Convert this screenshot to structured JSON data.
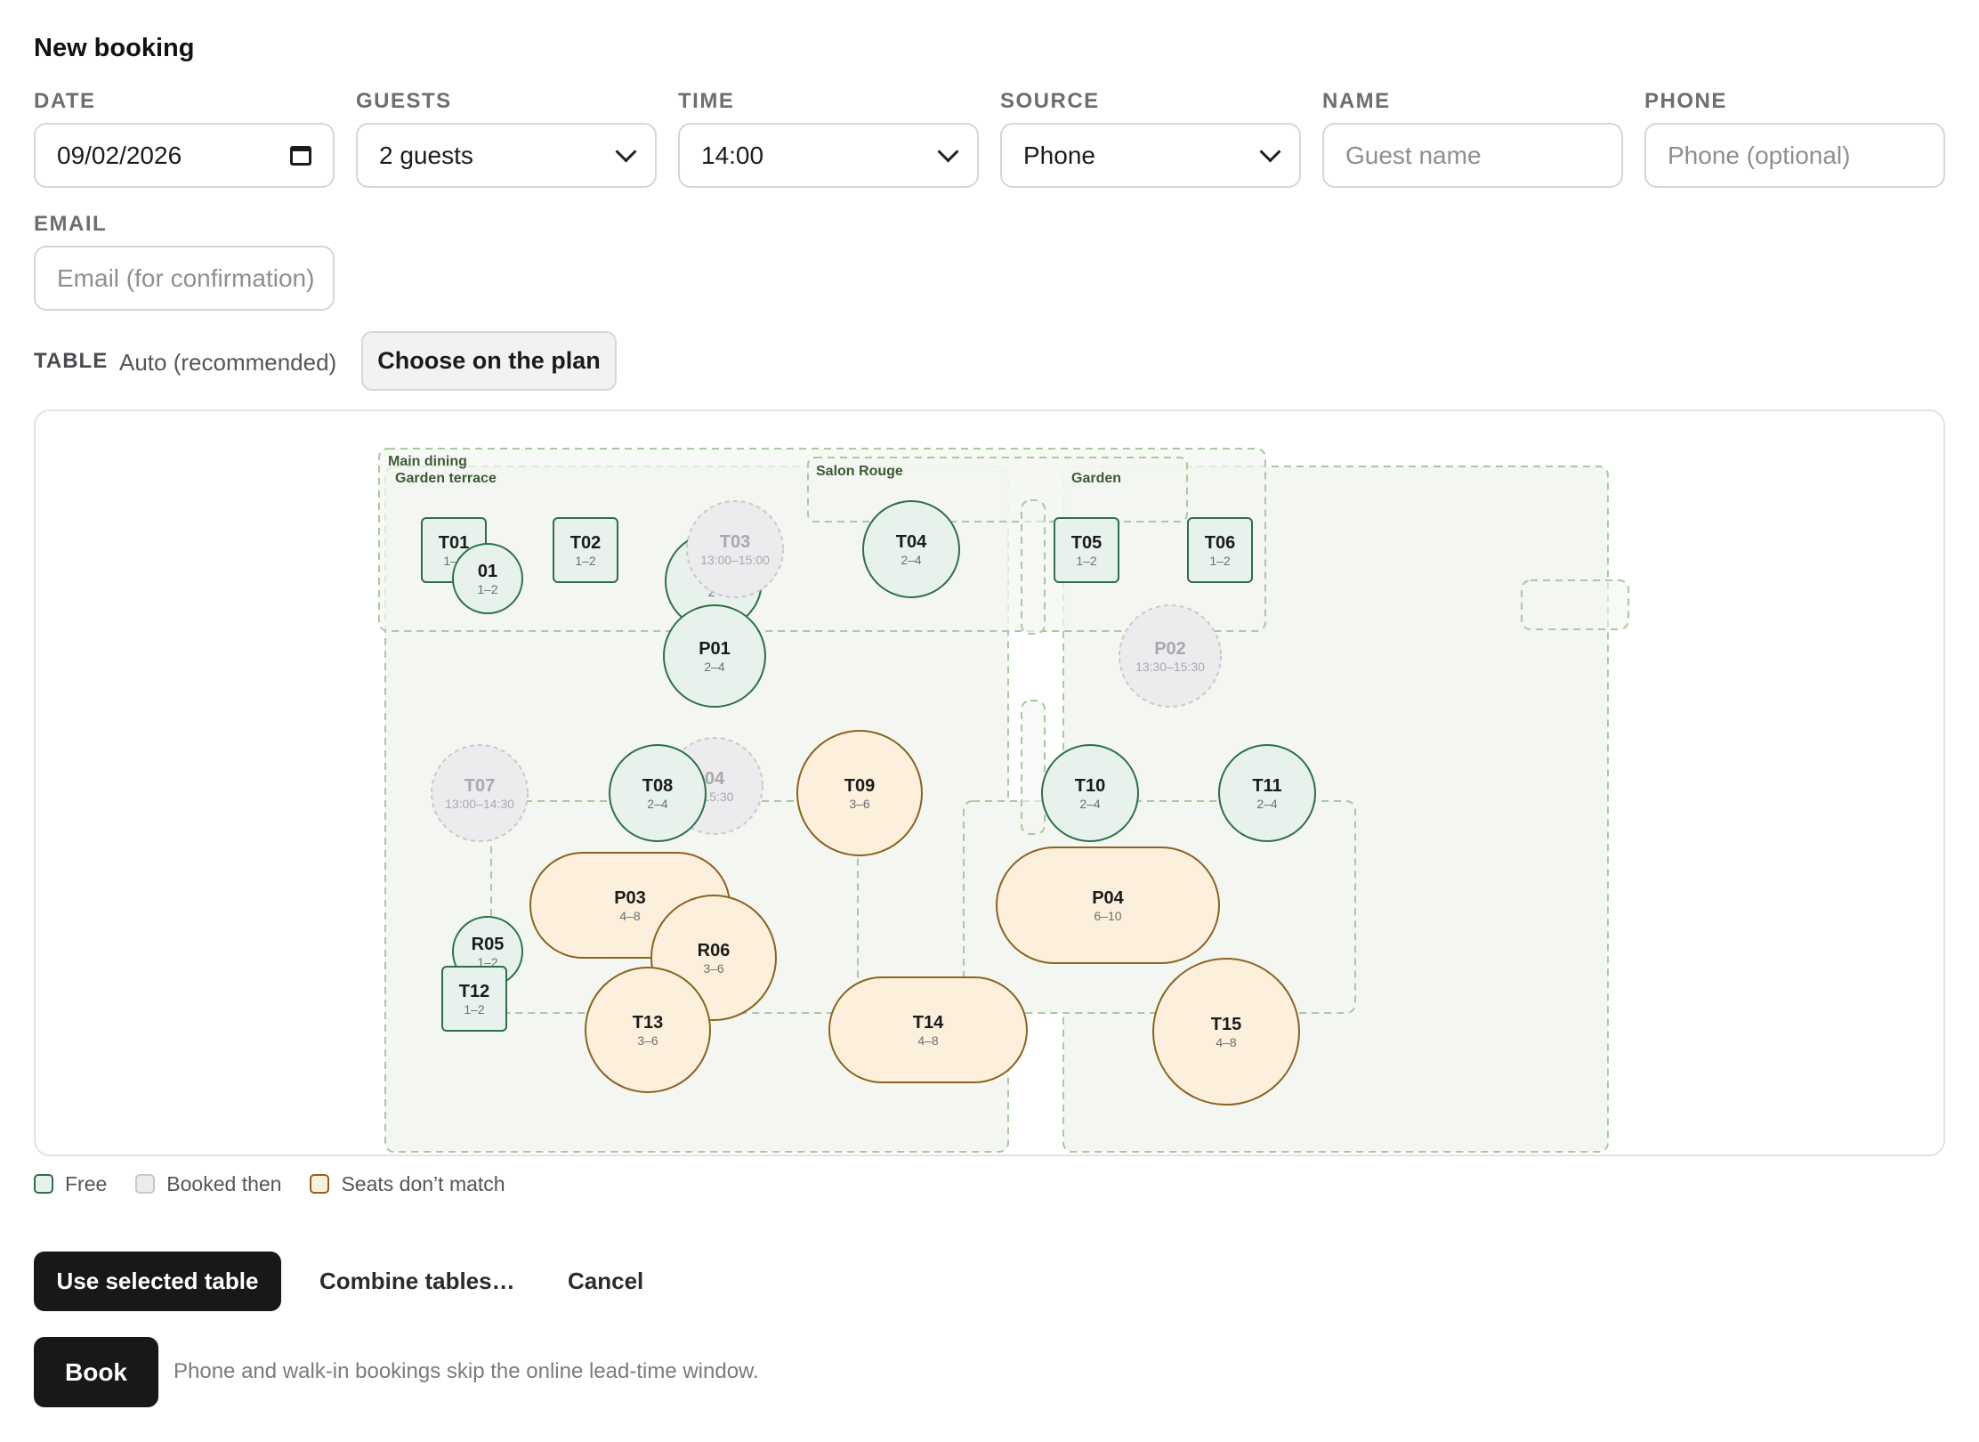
{
  "form": {
    "title": "New booking",
    "fields": {
      "date": {
        "label": "DATE",
        "value": "09/02/2026"
      },
      "guests": {
        "label": "GUESTS",
        "value": "2 guests"
      },
      "time": {
        "label": "TIME",
        "value": "14:00"
      },
      "source": {
        "label": "SOURCE",
        "value": "Phone"
      },
      "name": {
        "label": "NAME",
        "placeholder": "Guest name"
      },
      "phone": {
        "label": "PHONE",
        "placeholder": "Phone (optional)"
      },
      "email": {
        "label": "EMAIL",
        "placeholder": "Email (for confirmation)"
      }
    },
    "table": {
      "label": "TABLE",
      "value": "Auto (recommended)",
      "choose_button": "Choose on the plan"
    }
  },
  "plan": {
    "colors": {
      "free_fill": "#e8f2ec",
      "free_stroke": "#2f6e4a",
      "booked_fill": "#ececee",
      "booked_stroke": "#c9c9cd",
      "mismatch_fill": "#fcf0dc",
      "mismatch_stroke": "#8a6420",
      "zone_fill": "#f3f6f1",
      "zone_stroke": "#a9c9a0"
    },
    "zones": [
      {
        "name": "Main dining"
      },
      {
        "name": "Garden terrace"
      },
      {
        "name": "Salon Rouge"
      },
      {
        "name": "Garden"
      }
    ],
    "tables": [
      {
        "id": "T01",
        "status": "free",
        "seats": "1–2"
      },
      {
        "id": "R01",
        "label": "01",
        "status": "free",
        "seats": "1–2"
      },
      {
        "id": "T02",
        "status": "free",
        "seats": "1–2"
      },
      {
        "id": "R02",
        "label": "",
        "status": "free",
        "seats": "2-"
      },
      {
        "id": "T03",
        "status": "booked",
        "seats": "13:00–15:00"
      },
      {
        "id": "P01",
        "status": "free",
        "seats": "2–4"
      },
      {
        "id": "T04",
        "status": "free",
        "seats": "2–4"
      },
      {
        "id": "T05",
        "status": "free",
        "seats": "1–2"
      },
      {
        "id": "T06",
        "status": "free",
        "seats": "1–2"
      },
      {
        "id": "P02",
        "status": "booked",
        "seats": "13:30–15:30"
      },
      {
        "id": "T07",
        "status": "booked",
        "seats": "13:00–14:30"
      },
      {
        "id": "R04",
        "label": "04",
        "status": "booked",
        "seats": "–15:30"
      },
      {
        "id": "T08",
        "status": "free",
        "seats": "2–4"
      },
      {
        "id": "T09",
        "status": "mismatch",
        "seats": "3–6"
      },
      {
        "id": "T10",
        "status": "free",
        "seats": "2–4"
      },
      {
        "id": "T11",
        "status": "free",
        "seats": "2–4"
      },
      {
        "id": "P03",
        "status": "mismatch",
        "seats": "4–8"
      },
      {
        "id": "R06",
        "status": "mismatch",
        "seats": "3–6"
      },
      {
        "id": "P04",
        "status": "mismatch",
        "seats": "6–10"
      },
      {
        "id": "R05",
        "status": "free",
        "seats": "1–2"
      },
      {
        "id": "T12",
        "status": "free",
        "seats": "1–2"
      },
      {
        "id": "T13",
        "status": "mismatch",
        "seats": "3–6"
      },
      {
        "id": "T14",
        "status": "mismatch",
        "seats": "4–8"
      },
      {
        "id": "T15",
        "status": "mismatch",
        "seats": "4–8"
      }
    ]
  },
  "legend": [
    {
      "label": "Free",
      "status": "free"
    },
    {
      "label": "Booked then",
      "status": "booked"
    },
    {
      "label": "Seats don’t match",
      "status": "mismatch"
    }
  ],
  "actions": {
    "use_selected": "Use selected table",
    "combine": "Combine tables…",
    "cancel": "Cancel",
    "book": "Book",
    "note": "Phone and walk-in bookings skip the online lead-time window."
  }
}
